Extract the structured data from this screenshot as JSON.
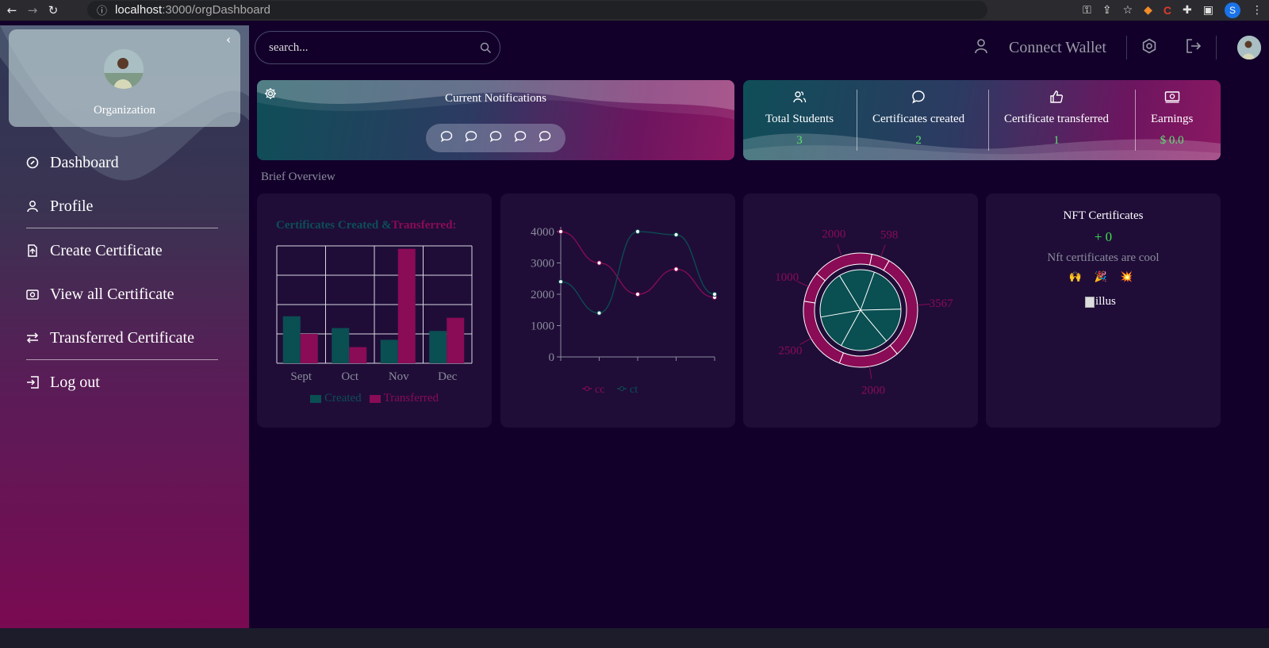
{
  "browser": {
    "url_host": "localhost",
    "url_path": ":3000/orgDashboard",
    "profile_initial": "S"
  },
  "sidebar": {
    "org_name": "Organization",
    "items": [
      {
        "label": "Dashboard",
        "icon": "dashboard-icon"
      },
      {
        "label": "Profile",
        "icon": "user-icon"
      },
      {
        "label": "Create Certificate",
        "icon": "file-plus-icon"
      },
      {
        "label": "View all Certificate",
        "icon": "view-certificate-icon"
      },
      {
        "label": "Transferred Certificate",
        "icon": "transfer-icon"
      },
      {
        "label": "Log out",
        "icon": "logout-icon"
      }
    ]
  },
  "topbar": {
    "search_placeholder": "search...",
    "connect_wallet": "Connect Wallet"
  },
  "notifications": {
    "title": "Current Notifications",
    "bubble_count": 5
  },
  "stats": [
    {
      "label": "Total Students",
      "value": "3",
      "icon": "students-icon"
    },
    {
      "label": "Certificates created",
      "value": "2",
      "icon": "comment-icon"
    },
    {
      "label": "Certificate transferred",
      "value": "1",
      "icon": "thumbs-up-icon"
    },
    {
      "label": "Earnings",
      "value": "$ 0.0",
      "icon": "money-icon"
    }
  ],
  "brief_overview": "Brief Overview",
  "colors": {
    "teal": "#0a4f52",
    "magenta": "#8a0b56",
    "stat_value": "#5be36f"
  },
  "chart_data": [
    {
      "type": "bar",
      "title_part1": "Certificates Created &",
      "title_part2": "Transferred:",
      "categories": [
        "Sept",
        "Oct",
        "Nov",
        "Dec"
      ],
      "series": [
        {
          "name": "Created",
          "values": [
            1600,
            1200,
            800,
            1100
          ]
        },
        {
          "name": "Transferred",
          "values": [
            1000,
            550,
            3900,
            1550
          ]
        }
      ],
      "ylim": [
        0,
        4000
      ],
      "legend": "bottom"
    },
    {
      "type": "line",
      "x": [
        "1",
        "2",
        "3",
        "4",
        "5"
      ],
      "ylim": [
        0,
        4000
      ],
      "yticks": [
        0,
        1000,
        2000,
        3000,
        4000
      ],
      "series": [
        {
          "name": "cc",
          "values": [
            4000,
            3000,
            2000,
            2800,
            1900
          ]
        },
        {
          "name": "ct",
          "values": [
            2400,
            1400,
            4000,
            3900,
            2000
          ]
        }
      ],
      "legend": "bottom"
    },
    {
      "type": "pie",
      "outer_labels": [
        "3567",
        "2000",
        "2500",
        "1000",
        "2000",
        "598"
      ],
      "outer_values": [
        3567,
        2000,
        2500,
        1000,
        2000,
        598
      ],
      "inner_slice_count": 6
    }
  ],
  "nft": {
    "title": "NFT Certificates",
    "count": "+ 0",
    "subtitle": "Nft certificates are cool",
    "emoji": "🙌 🎉 💥",
    "image_alt": "illus"
  }
}
